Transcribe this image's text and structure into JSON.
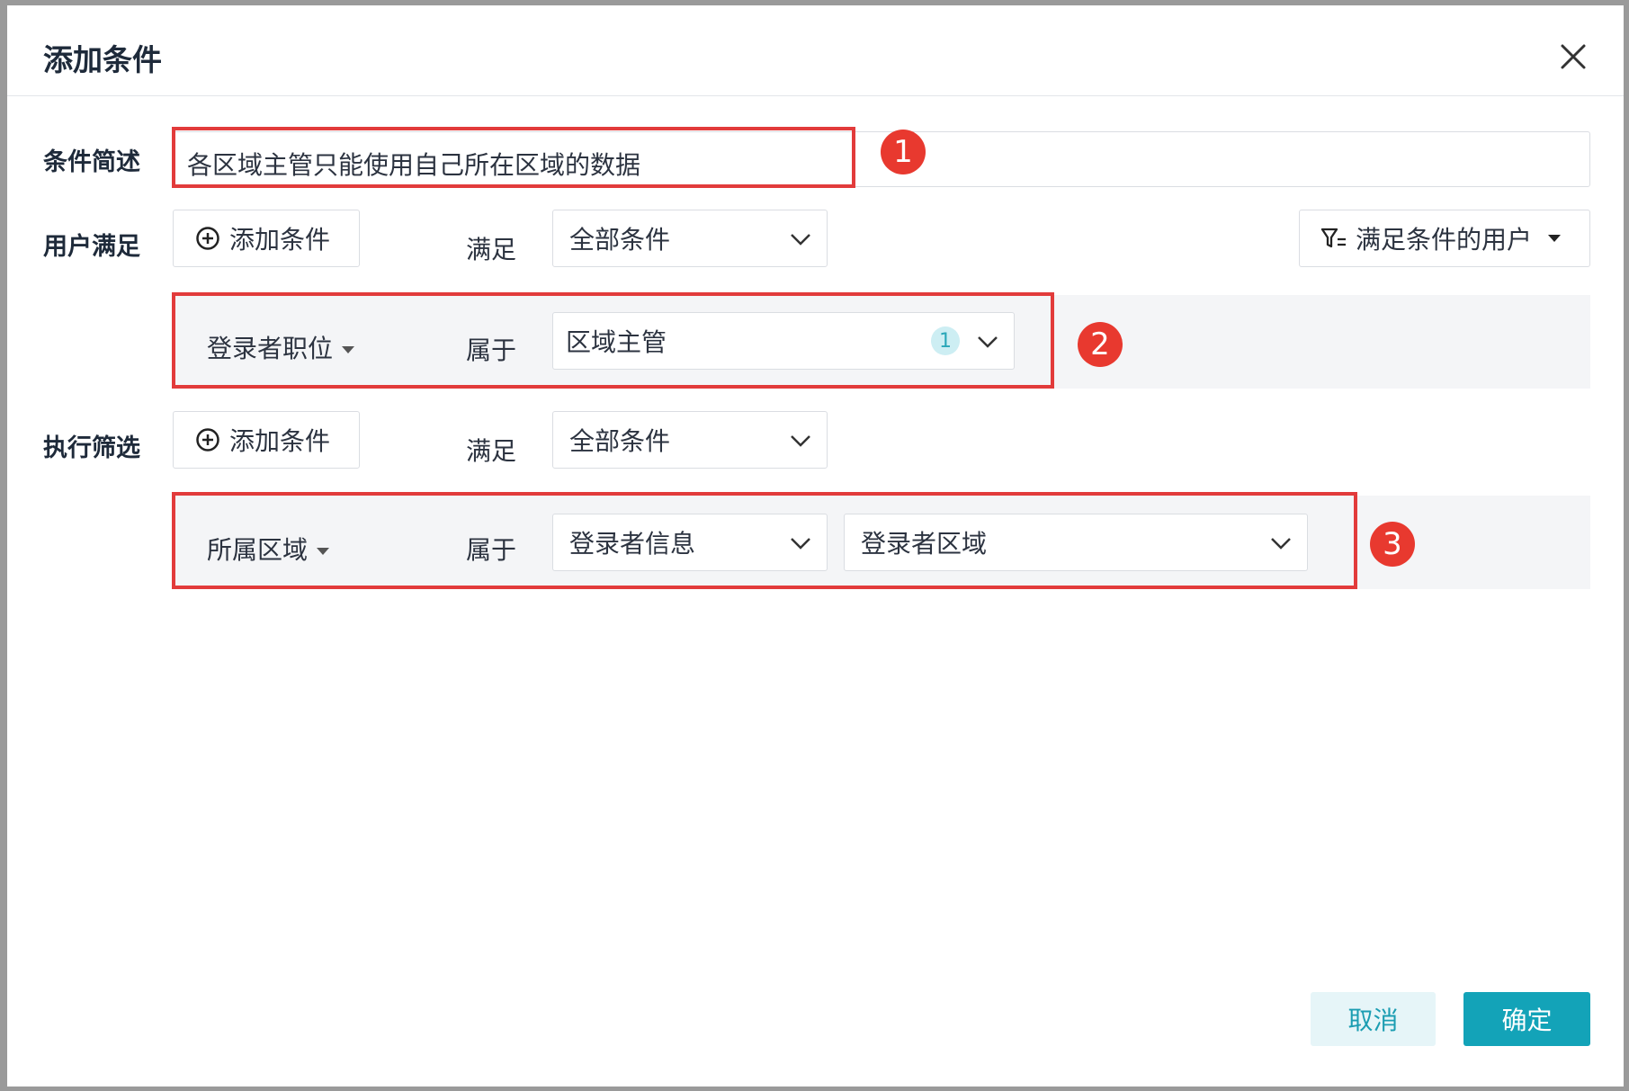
{
  "dialog": {
    "title": "添加条件",
    "close_icon": "close-icon"
  },
  "description": {
    "label": "条件简述",
    "value": "各区域主管只能使用自己所在区域的数据"
  },
  "user_condition": {
    "label": "用户满足",
    "add_button": "添加条件",
    "satisfy_label": "满足",
    "satisfy_select": "全部条件",
    "filter_users_button": "满足条件的用户",
    "rule": {
      "field": "登录者职位",
      "operator": "属于",
      "value": "区域主管",
      "value_count": "1"
    }
  },
  "filter_condition": {
    "label": "执行筛选",
    "add_button": "添加条件",
    "satisfy_label": "满足",
    "satisfy_select": "全部条件",
    "rule": {
      "field": "所属区域",
      "operator": "属于",
      "source_select": "登录者信息",
      "value_select": "登录者区域"
    }
  },
  "annotations": [
    "1",
    "2",
    "3"
  ],
  "footer": {
    "cancel": "取消",
    "confirm": "确定"
  },
  "colors": {
    "accent": "#13a3b8",
    "annotation_red": "#e23b3b"
  }
}
